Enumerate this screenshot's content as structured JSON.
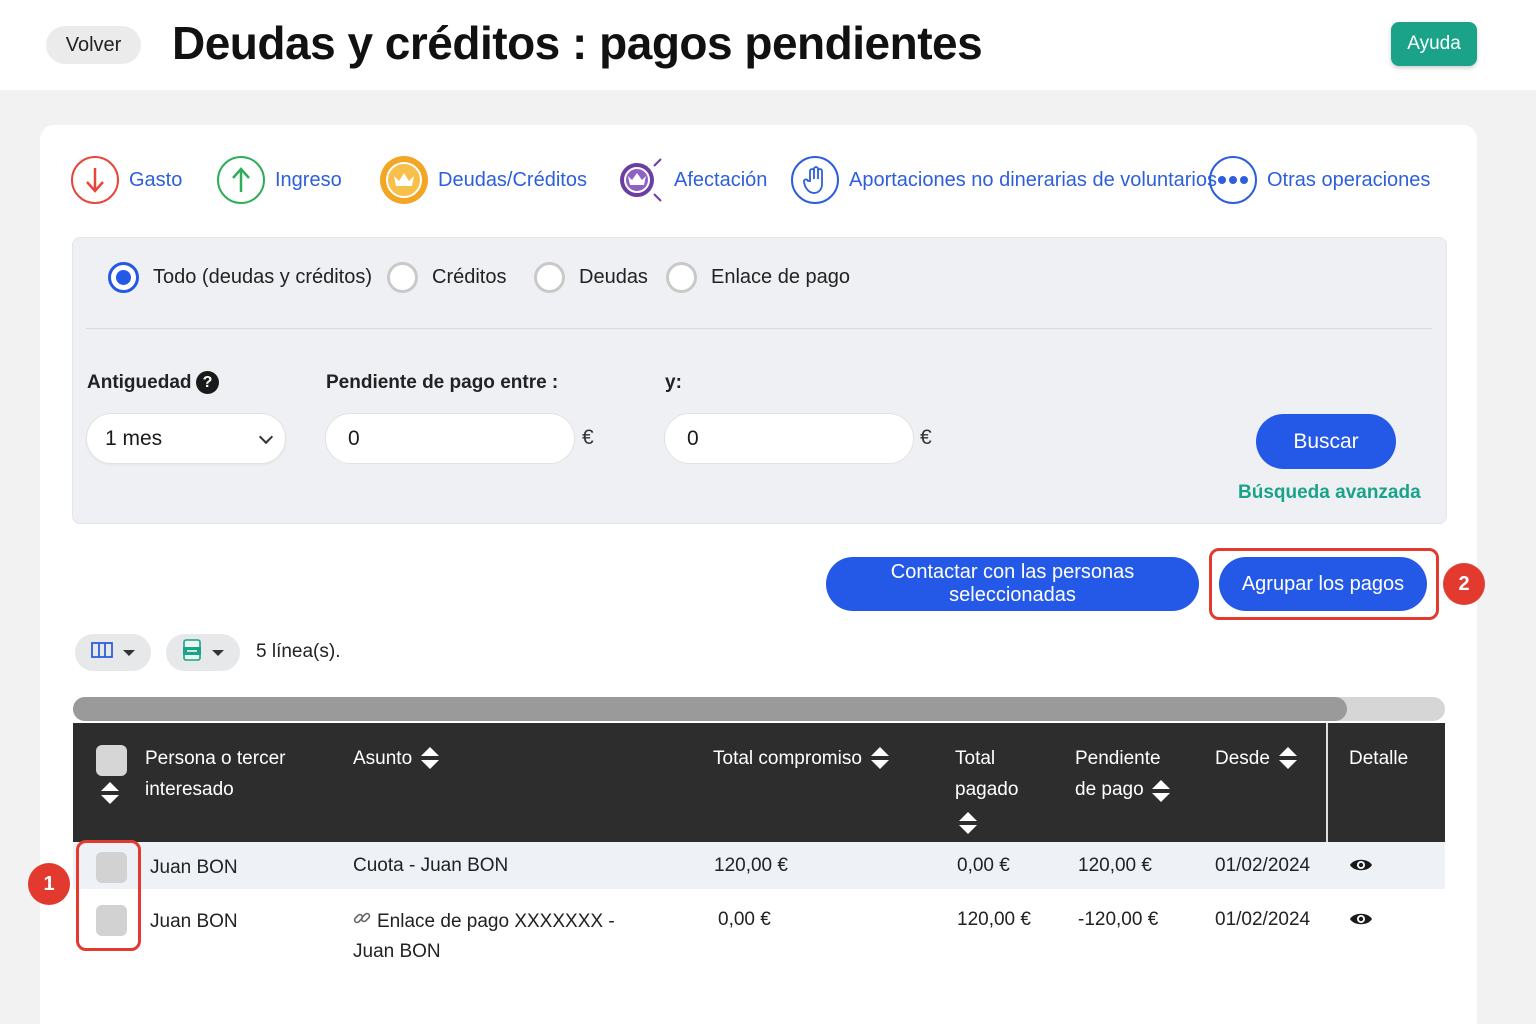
{
  "header": {
    "back_label": "Volver",
    "title": "Deudas y créditos : pagos pendientes",
    "help_label": "Ayuda"
  },
  "operation_tabs": [
    {
      "label": "Gasto",
      "icon": "arrow-down-icon",
      "color": "#e5483b"
    },
    {
      "label": "Ingreso",
      "icon": "arrow-up-icon",
      "color": "#2fae5a"
    },
    {
      "label": "Deudas/Créditos",
      "icon": "crown-icon",
      "color": "#f2a623"
    },
    {
      "label": "Afectación",
      "icon": "crown-arrows-icon",
      "color": "#6a3fa0"
    },
    {
      "label": "Aportaciones no dinerarias de voluntarios",
      "icon": "hand-icon",
      "color": "#2d5fdc"
    },
    {
      "label": "Otras operaciones",
      "icon": "more-dots-icon",
      "color": "#2d5fdc"
    }
  ],
  "filters": {
    "type_options": [
      {
        "label": "Todo (deudas y créditos)",
        "checked": true
      },
      {
        "label": "Créditos",
        "checked": false
      },
      {
        "label": "Deudas",
        "checked": false
      },
      {
        "label": "Enlace de pago",
        "checked": false
      }
    ],
    "age_label": "Antiguedad",
    "age_value": "1 mes",
    "pending_between_label": "Pendiente de pago entre :",
    "pending_min": "0",
    "and_label": "y:",
    "pending_max": "0",
    "currency": "€",
    "search_label": "Buscar",
    "advanced_label": "Búsqueda avanzada"
  },
  "actions": {
    "contact_label": "Contactar con las personas seleccionadas",
    "group_label": "Agrupar los pagos"
  },
  "annotations": {
    "step1": "1",
    "step2": "2"
  },
  "table": {
    "lines_count": "5 línea(s).",
    "columns": {
      "person": "Persona o tercer interesado",
      "subject": "Asunto",
      "total": "Total compromiso",
      "paid": "Total pagado",
      "pending": "Pendiente de pago",
      "since": "Desde",
      "detail": "Detalle"
    },
    "rows": [
      {
        "person": "Juan BON",
        "subject": "Cuota - Juan BON",
        "total": "120,00 €",
        "paid": "0,00 €",
        "pending": "120,00 €",
        "since": "01/02/2024"
      },
      {
        "person": "Juan BON",
        "subject": "Enlace de pago XXXXXXX - Juan BON",
        "total": "0,00 €",
        "paid": "120,00 €",
        "pending": "-120,00 €",
        "since": "01/02/2024"
      }
    ]
  }
}
